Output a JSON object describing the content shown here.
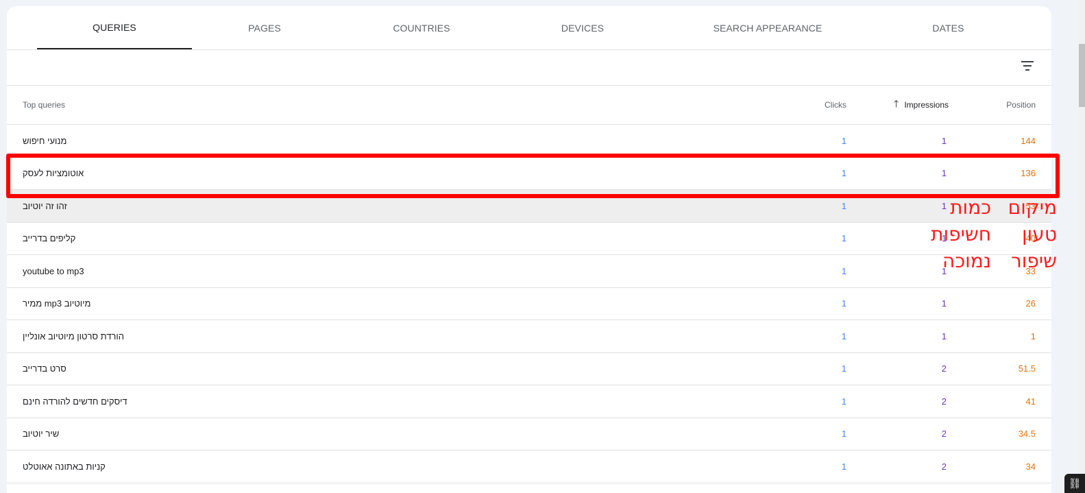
{
  "tabs": [
    {
      "label": "QUERIES",
      "active": true
    },
    {
      "label": "PAGES",
      "active": false
    },
    {
      "label": "COUNTRIES",
      "active": false
    },
    {
      "label": "DEVICES",
      "active": false
    },
    {
      "label": "SEARCH APPEARANCE",
      "active": false
    },
    {
      "label": "DATES",
      "active": false
    }
  ],
  "toolbar": {
    "filter_icon": "filter-list-icon"
  },
  "table": {
    "headers": {
      "query": "Top queries",
      "clicks": "Clicks",
      "impressions": "Impressions",
      "position": "Position"
    },
    "sort": {
      "column": "impressions",
      "direction": "ascending",
      "icon": "arrow-up-icon"
    },
    "rows": [
      {
        "query": "מנועי חיפוש",
        "clicks": "1",
        "impressions": "1",
        "position": "144"
      },
      {
        "query": "אוטומציות לעסק",
        "clicks": "1",
        "impressions": "1",
        "position": "136"
      },
      {
        "query": "זהו זה יוטיוב",
        "clicks": "1",
        "impressions": "1",
        "position": "53"
      },
      {
        "query": "קליפים בדרייב",
        "clicks": "1",
        "impressions": "1",
        "position": "40"
      },
      {
        "query": "youtube to mp3",
        "clicks": "1",
        "impressions": "1",
        "position": "33"
      },
      {
        "query": "ממיר mp3 מיוטיוב",
        "clicks": "1",
        "impressions": "1",
        "position": "26"
      },
      {
        "query": "הורדת סרטון מיוטיוב אונליין",
        "clicks": "1",
        "impressions": "1",
        "position": "1"
      },
      {
        "query": "סרט בדרייב",
        "clicks": "1",
        "impressions": "2",
        "position": "51.5"
      },
      {
        "query": "דיסקים חדשים להורדה חינם",
        "clicks": "1",
        "impressions": "2",
        "position": "41"
      },
      {
        "query": "שיר יוטיוב",
        "clicks": "1",
        "impressions": "2",
        "position": "34.5"
      },
      {
        "query": "קניות באתונה אאוטלט",
        "clicks": "1",
        "impressions": "2",
        "position": "34"
      }
    ],
    "hovered_row_index": 2,
    "highlighted_row_index": 1
  },
  "annotations": {
    "impressions_note": [
      "כמות",
      "חשיפות",
      "נמוכה"
    ],
    "position_note": [
      "מיקום",
      "טעון",
      "שיפור"
    ],
    "color": "#ff0000"
  },
  "colors": {
    "clicks": "#4285f4",
    "impressions": "#673ab7",
    "position": "#e8710a"
  },
  "corner_widget": {
    "icon": "link-icon"
  }
}
